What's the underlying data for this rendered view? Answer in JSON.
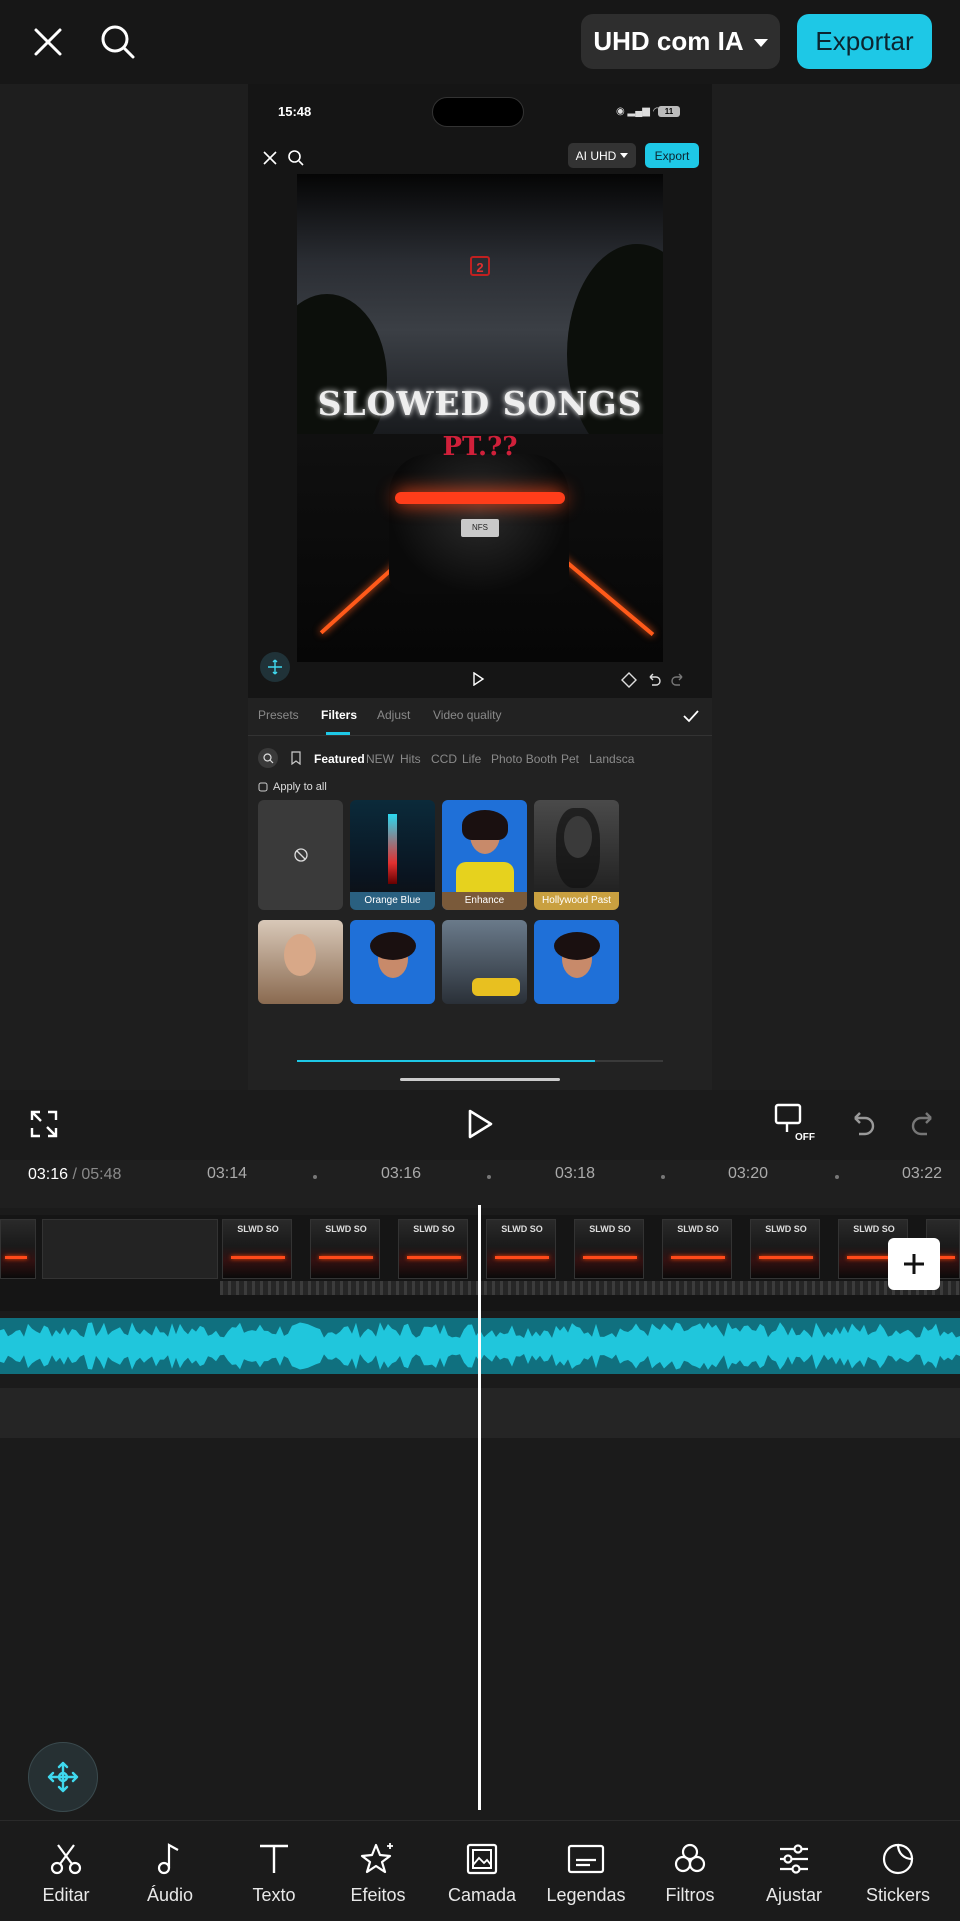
{
  "header": {
    "quality_label": "UHD com IA",
    "export_label": "Exportar"
  },
  "phone": {
    "status_time": "15:48",
    "battery": "11",
    "quality_label": "AI UHD",
    "export_label": "Export",
    "video_title_line1": "SLOWED SONGS",
    "video_title_line2": "PT.??",
    "video_badge": "2",
    "plate": "NFS",
    "panel_tabs": [
      "Presets",
      "Filters",
      "Adjust",
      "Video quality"
    ],
    "categories": [
      "Featured",
      "NEW",
      "Hits",
      "CCD",
      "Life",
      "Photo Booth",
      "Pet",
      "Landsca"
    ],
    "apply_all": "Apply to all",
    "filters": [
      {
        "label": "",
        "type": "none"
      },
      {
        "label": "Orange Blue",
        "type": "city"
      },
      {
        "label": "Enhance",
        "type": "portrait-blue"
      },
      {
        "label": "Hollywood Past",
        "type": "bw"
      },
      {
        "label": "",
        "type": "portrait-warm"
      },
      {
        "label": "",
        "type": "portrait-blue"
      },
      {
        "label": "",
        "type": "street"
      },
      {
        "label": "",
        "type": "portrait-blue"
      }
    ]
  },
  "timeline": {
    "current_time": "03:16",
    "total_time": " / 05:48",
    "ruler": [
      "03:14",
      "03:16",
      "03:18",
      "03:20",
      "03:22"
    ],
    "clip_thumb_text": "SLWD SO"
  },
  "toolbar": {
    "items": [
      {
        "label": "Editar",
        "icon": "scissors-icon"
      },
      {
        "label": "Áudio",
        "icon": "music-note-icon"
      },
      {
        "label": "Texto",
        "icon": "text-icon"
      },
      {
        "label": "Efeitos",
        "icon": "sparkle-star-icon"
      },
      {
        "label": "Camada",
        "icon": "image-layer-icon"
      },
      {
        "label": "Legendas",
        "icon": "captions-icon"
      },
      {
        "label": "Filtros",
        "icon": "filters-icon"
      },
      {
        "label": "Ajustar",
        "icon": "sliders-icon"
      },
      {
        "label": "Stickers",
        "icon": "sticker-icon"
      }
    ]
  },
  "colors": {
    "accent": "#1ec8e6",
    "audio_track": "#10707f",
    "background": "#1b1b1b"
  }
}
